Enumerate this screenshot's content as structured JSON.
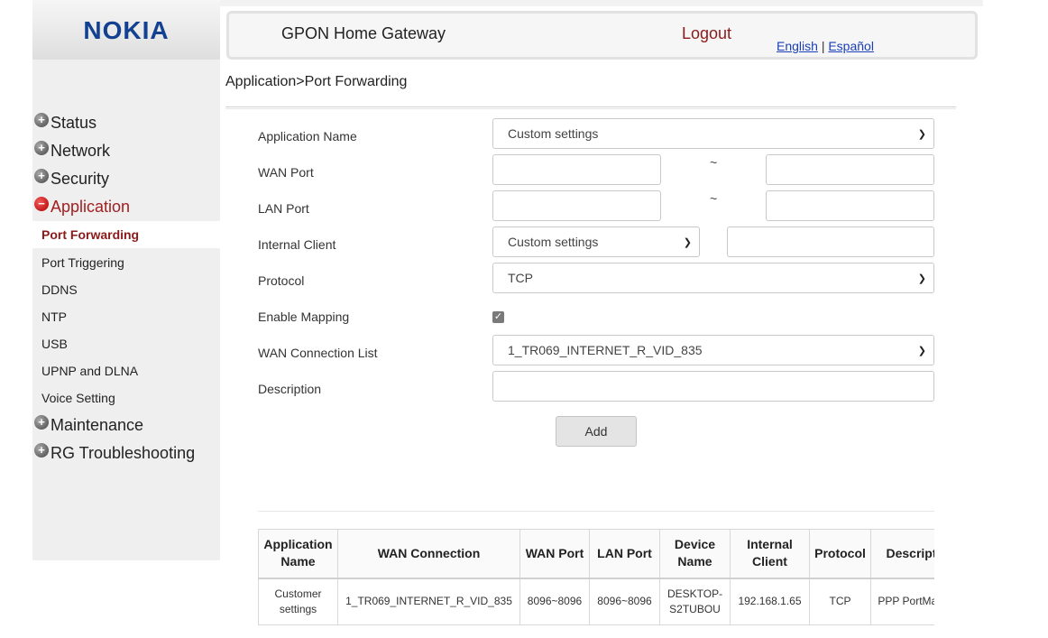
{
  "header": {
    "logo": "NOKIA",
    "title": "GPON Home Gateway",
    "logout": "Logout",
    "lang_english": "English",
    "lang_sep": "|",
    "lang_espanol": "Español"
  },
  "breadcrumb": "Application>Port Forwarding",
  "sidebar": {
    "categories": [
      {
        "label": "Status",
        "state": "collapsed"
      },
      {
        "label": "Network",
        "state": "collapsed"
      },
      {
        "label": "Security",
        "state": "collapsed"
      },
      {
        "label": "Application",
        "state": "expanded"
      },
      {
        "label": "Maintenance",
        "state": "collapsed"
      },
      {
        "label": "RG Troubleshooting",
        "state": "collapsed"
      }
    ],
    "subitems": [
      {
        "label": "Port Forwarding",
        "selected": true
      },
      {
        "label": "Port Triggering",
        "selected": false
      },
      {
        "label": "DDNS",
        "selected": false
      },
      {
        "label": "NTP",
        "selected": false
      },
      {
        "label": "USB",
        "selected": false
      },
      {
        "label": "UPNP and DLNA",
        "selected": false
      },
      {
        "label": "Voice Setting",
        "selected": false
      }
    ]
  },
  "form": {
    "app_name_label": "Application Name",
    "app_name_value": "Custom settings",
    "wan_port_label": "WAN Port",
    "wan_port_from": "",
    "wan_port_to": "",
    "lan_port_label": "LAN Port",
    "lan_port_from": "",
    "lan_port_to": "",
    "tilde": "~",
    "internal_client_label": "Internal Client",
    "internal_client_value": "Custom settings",
    "internal_client_ip": "",
    "protocol_label": "Protocol",
    "protocol_value": "TCP",
    "enable_mapping_label": "Enable Mapping",
    "enable_mapping_checked": true,
    "wan_conn_label": "WAN Connection List",
    "wan_conn_value": "1_TR069_INTERNET_R_VID_835",
    "description_label": "Description",
    "description_value": "",
    "add_button": "Add"
  },
  "table": {
    "headers": [
      "Application Name",
      "WAN Connection",
      "WAN Port",
      "LAN Port",
      "Device Name",
      "Internal Client",
      "Protocol",
      "Description"
    ],
    "rows": [
      [
        "Customer settings",
        "1_TR069_INTERNET_R_VID_835",
        "8096~8096",
        "8096~8096",
        "DESKTOP-S2TUBOU",
        "192.168.1.65",
        "TCP",
        "PPP PortMapping"
      ]
    ]
  },
  "colors": {
    "brand": "#124191",
    "accent_red": "#8b1a1a",
    "link_blue": "#1a3fb8"
  },
  "icons": {
    "expand": "plus-circle-icon",
    "collapse": "minus-circle-icon",
    "select": "chevron-down-icon",
    "checkbox": "checkmark-icon"
  }
}
